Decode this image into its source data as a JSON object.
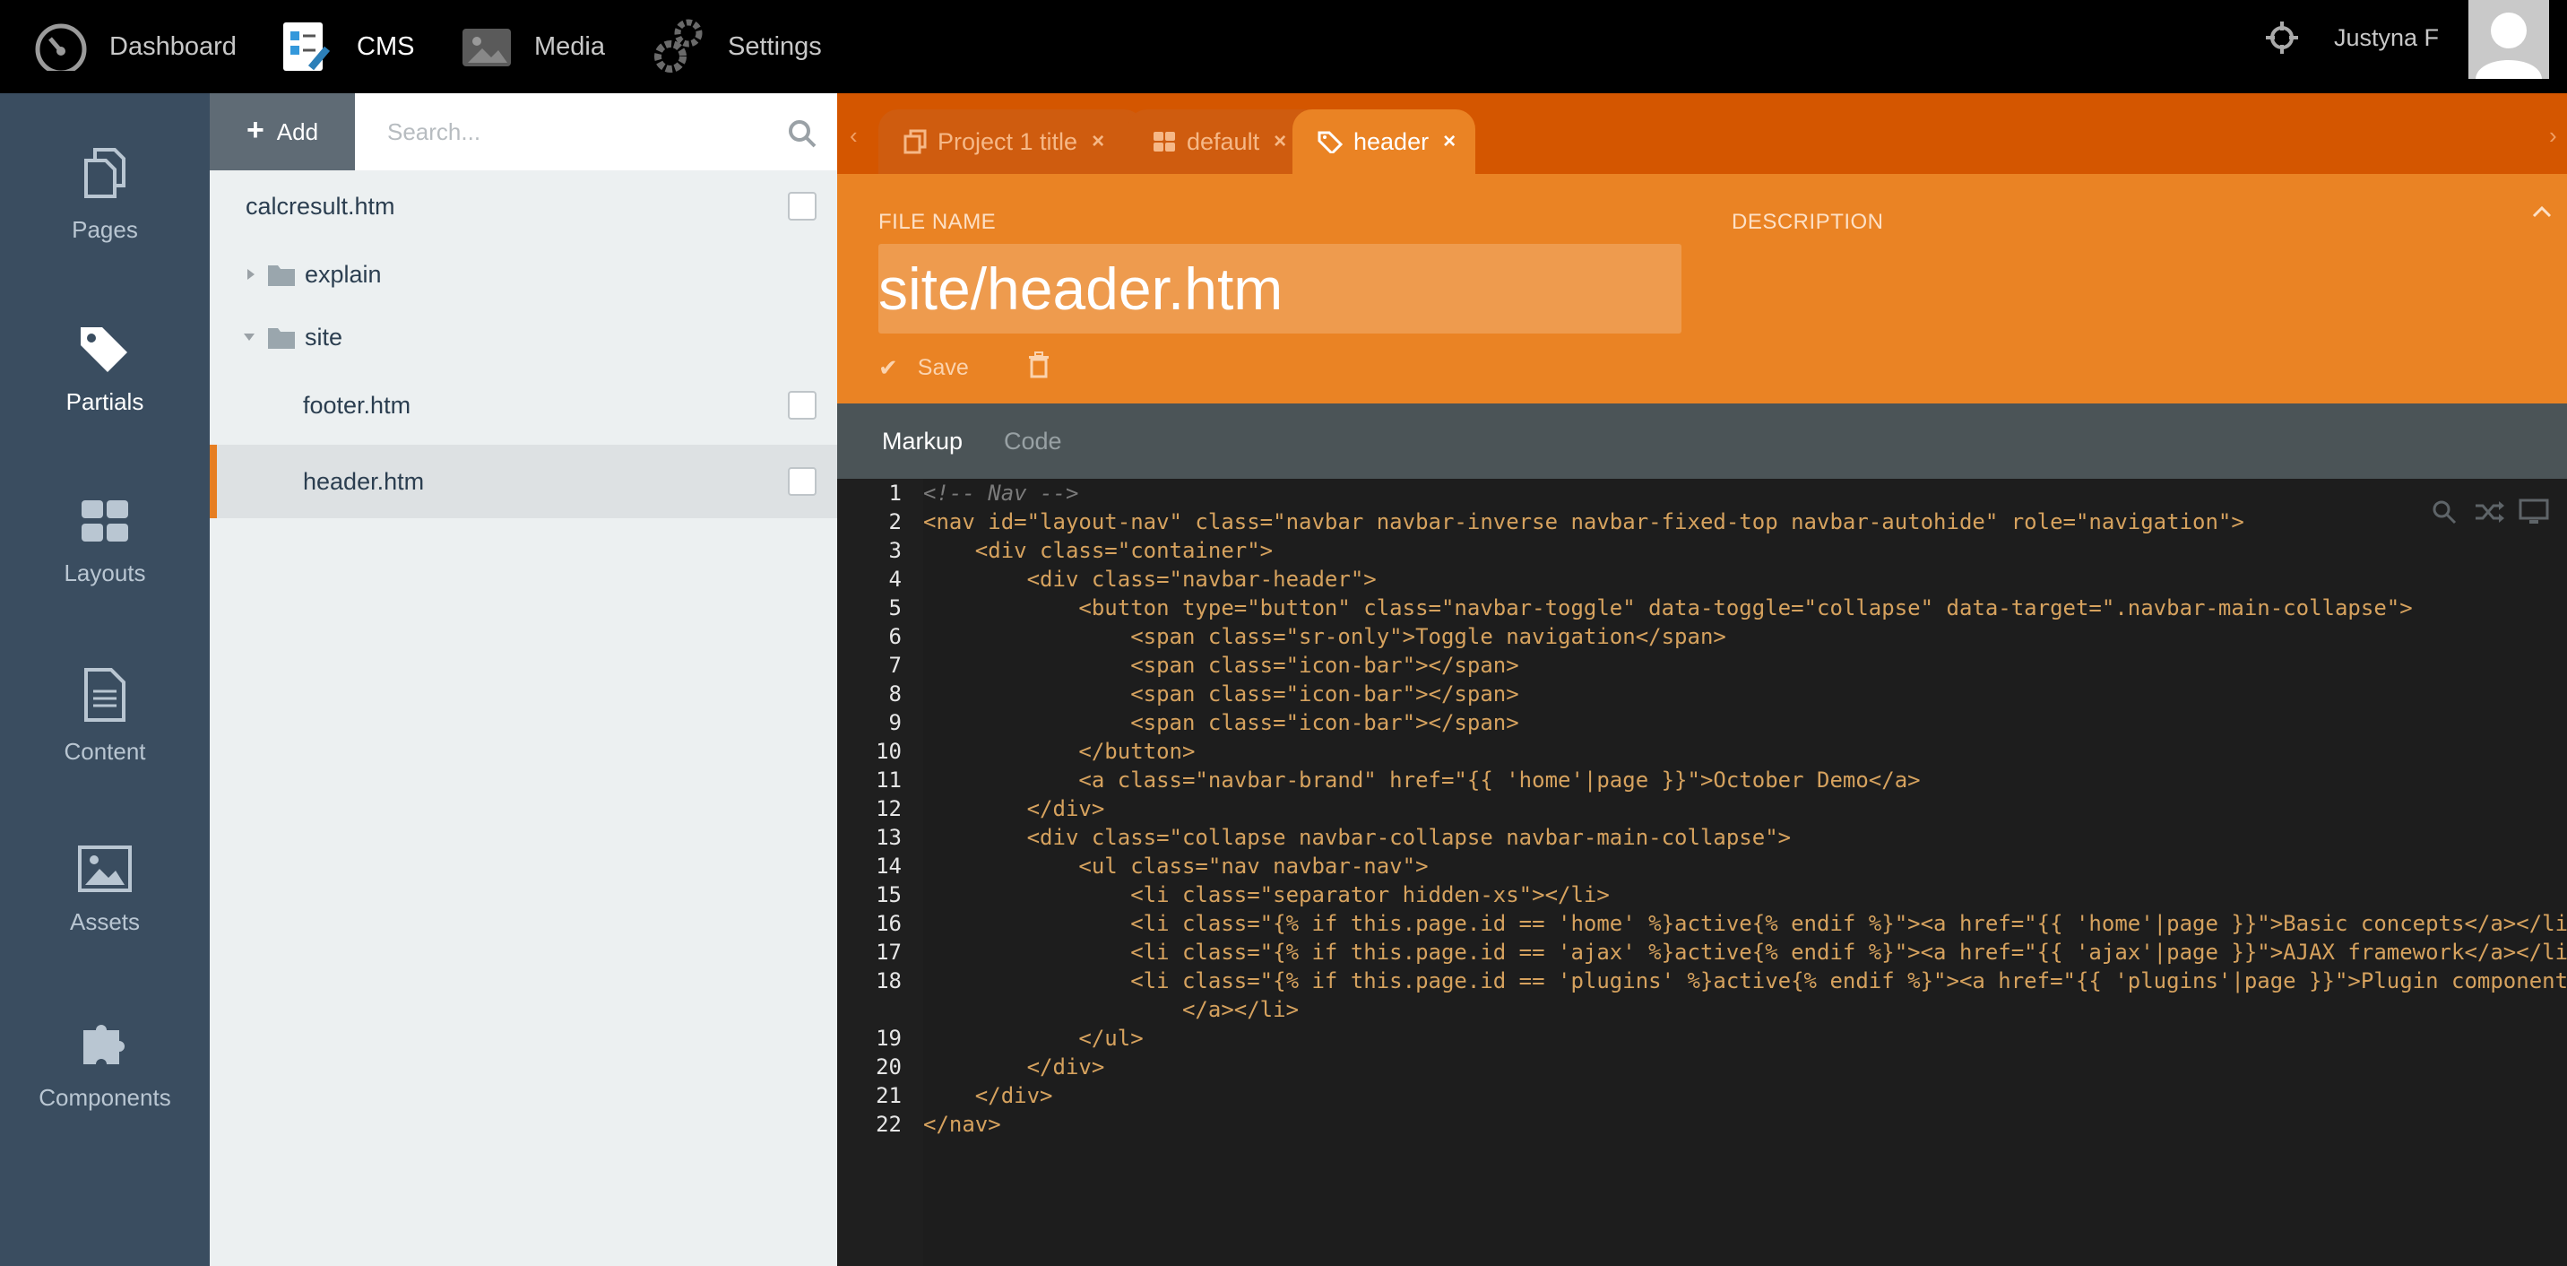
{
  "topnav": {
    "items": [
      {
        "label": "Dashboard",
        "icon": "speedometer-icon"
      },
      {
        "label": "CMS",
        "icon": "cms-icon"
      },
      {
        "label": "Media",
        "icon": "image-icon"
      },
      {
        "label": "Settings",
        "icon": "gears-icon"
      }
    ],
    "active": "CMS",
    "user_name": "Justyna F"
  },
  "sidebar": {
    "items": [
      {
        "label": "Pages",
        "icon": "pages-icon"
      },
      {
        "label": "Partials",
        "icon": "tags-icon"
      },
      {
        "label": "Layouts",
        "icon": "layouts-icon"
      },
      {
        "label": "Content",
        "icon": "document-icon"
      },
      {
        "label": "Assets",
        "icon": "picture-icon"
      },
      {
        "label": "Components",
        "icon": "puzzle-icon"
      }
    ],
    "active": "Partials"
  },
  "tree": {
    "add_label": "Add",
    "search_placeholder": "Search...",
    "rows": [
      {
        "label": "calcresult.htm",
        "type": "file"
      },
      {
        "label": "explain",
        "type": "folder",
        "expanded": false
      },
      {
        "label": "site",
        "type": "folder",
        "expanded": true
      },
      {
        "label": "footer.htm",
        "type": "file"
      },
      {
        "label": "header.htm",
        "type": "file",
        "selected": true
      }
    ]
  },
  "tabs": [
    {
      "label": "Project 1 title",
      "icon": "copy-icon"
    },
    {
      "label": "default",
      "icon": "grid-icon"
    },
    {
      "label": "header",
      "icon": "tags-icon",
      "active": true
    }
  ],
  "form": {
    "file_name_label": "FILE NAME",
    "description_label": "DESCRIPTION",
    "file_name_value": "site/header.htm",
    "save_label": "Save"
  },
  "editor_tabs": {
    "markup": "Markup",
    "code": "Code",
    "active": "Markup"
  },
  "code_lines": [
    {
      "n": "1",
      "text": "<!-- Nav -->"
    },
    {
      "n": "2",
      "text": "<nav id=\"layout-nav\" class=\"navbar navbar-inverse navbar-fixed-top navbar-autohide\" role=\"navigation\">"
    },
    {
      "n": "3",
      "text": "    <div class=\"container\">"
    },
    {
      "n": "4",
      "text": "        <div class=\"navbar-header\">"
    },
    {
      "n": "5",
      "text": "            <button type=\"button\" class=\"navbar-toggle\" data-toggle=\"collapse\" data-target=\".navbar-main-collapse\">"
    },
    {
      "n": "6",
      "text": "                <span class=\"sr-only\">Toggle navigation</span>"
    },
    {
      "n": "7",
      "text": "                <span class=\"icon-bar\"></span>"
    },
    {
      "n": "8",
      "text": "                <span class=\"icon-bar\"></span>"
    },
    {
      "n": "9",
      "text": "                <span class=\"icon-bar\"></span>"
    },
    {
      "n": "10",
      "text": "            </button>"
    },
    {
      "n": "11",
      "text": "            <a class=\"navbar-brand\" href=\"{{ 'home'|page }}\">October Demo</a>"
    },
    {
      "n": "12",
      "text": "        </div>"
    },
    {
      "n": "13",
      "text": "        <div class=\"collapse navbar-collapse navbar-main-collapse\">"
    },
    {
      "n": "14",
      "text": "            <ul class=\"nav navbar-nav\">"
    },
    {
      "n": "15",
      "text": "                <li class=\"separator hidden-xs\"></li>"
    },
    {
      "n": "16",
      "text": "                <li class=\"{% if this.page.id == 'home' %}active{% endif %}\"><a href=\"{{ 'home'|page }}\">Basic concepts</a></li>"
    },
    {
      "n": "17",
      "text": "                <li class=\"{% if this.page.id == 'ajax' %}active{% endif %}\"><a href=\"{{ 'ajax'|page }}\">AJAX framework</a></li>"
    },
    {
      "n": "18",
      "text": "                <li class=\"{% if this.page.id == 'plugins' %}active{% endif %}\"><a href=\"{{ 'plugins'|page }}\">Plugin components"
    },
    {
      "n": "",
      "text": "                    </a></li>"
    },
    {
      "n": "19",
      "text": "            </ul>"
    },
    {
      "n": "20",
      "text": "        </div>"
    },
    {
      "n": "21",
      "text": "    </div>"
    },
    {
      "n": "22",
      "text": "</nav>"
    }
  ],
  "colors": {
    "topbar": "#000000",
    "sidebar": "#3a4d60",
    "accent_orange": "#ea8324",
    "tabbar_orange": "#d45600",
    "editor_bg": "#1d1d1d"
  }
}
